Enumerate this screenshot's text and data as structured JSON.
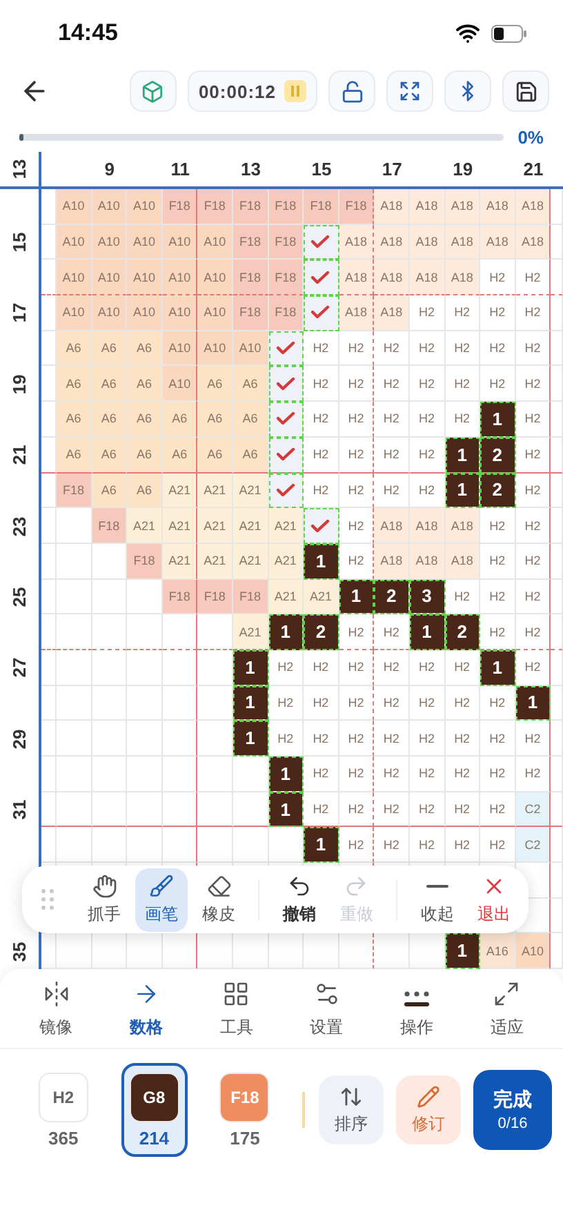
{
  "status_bar": {
    "time": "14:45"
  },
  "toolbar": {
    "timer": "00:00:12"
  },
  "progress": {
    "level": 0,
    "reading": "0%"
  },
  "grid": {
    "corner_label": "13",
    "column_labels": [
      "9",
      "11",
      "13",
      "15",
      "17",
      "19",
      "21"
    ],
    "rows": [
      {
        "cells": [
          {
            "kind": "code",
            "text": "A10",
            "color": "#f9d8bf"
          },
          {
            "kind": "code",
            "text": "A10",
            "color": "#f9d8bf"
          },
          {
            "kind": "code",
            "text": "A10",
            "color": "#f9d8bf"
          },
          {
            "kind": "code",
            "text": "F18",
            "color": "#f6c9bc"
          },
          {
            "kind": "code",
            "text": "F18",
            "color": "#f6c9bc"
          },
          {
            "kind": "code",
            "text": "F18",
            "color": "#f6c9bc"
          },
          {
            "kind": "code",
            "text": "F18",
            "color": "#f6c9bc"
          },
          {
            "kind": "code",
            "text": "F18",
            "color": "#f6c9bc"
          },
          {
            "kind": "code",
            "text": "F18",
            "color": "#f6c9bc"
          },
          {
            "kind": "code",
            "text": "A18",
            "color": "#fdeadb"
          },
          {
            "kind": "code",
            "text": "A18",
            "color": "#fdeadb"
          },
          {
            "kind": "code",
            "text": "A18",
            "color": "#fdeadb"
          },
          {
            "kind": "code",
            "text": "A18",
            "color": "#fdeadb"
          },
          {
            "kind": "code",
            "text": "A18",
            "color": "#fdeadb"
          }
        ]
      },
      {
        "label": "15",
        "cells": [
          {
            "kind": "code",
            "text": "A10",
            "color": "#f9d8bf"
          },
          {
            "kind": "code",
            "text": "A10",
            "color": "#f9d8bf"
          },
          {
            "kind": "code",
            "text": "A10",
            "color": "#f9d8bf"
          },
          {
            "kind": "code",
            "text": "A10",
            "color": "#f9d8bf"
          },
          {
            "kind": "code",
            "text": "A10",
            "color": "#f9d8bf"
          },
          {
            "kind": "code",
            "text": "F18",
            "color": "#f6c9bc"
          },
          {
            "kind": "code",
            "text": "F18",
            "color": "#f6c9bc"
          },
          {
            "kind": "check"
          },
          {
            "kind": "code",
            "text": "A18",
            "color": "#fdeadb"
          },
          {
            "kind": "code",
            "text": "A18",
            "color": "#fdeadb"
          },
          {
            "kind": "code",
            "text": "A18",
            "color": "#fdeadb"
          },
          {
            "kind": "code",
            "text": "A18",
            "color": "#fdeadb"
          },
          {
            "kind": "code",
            "text": "A18",
            "color": "#fdeadb"
          },
          {
            "kind": "code",
            "text": "A18",
            "color": "#fdeadb"
          }
        ]
      },
      {
        "cells": [
          {
            "kind": "code",
            "text": "A10",
            "color": "#f9d8bf"
          },
          {
            "kind": "code",
            "text": "A10",
            "color": "#f9d8bf"
          },
          {
            "kind": "code",
            "text": "A10",
            "color": "#f9d8bf"
          },
          {
            "kind": "code",
            "text": "A10",
            "color": "#f9d8bf"
          },
          {
            "kind": "code",
            "text": "A10",
            "color": "#f9d8bf"
          },
          {
            "kind": "code",
            "text": "F18",
            "color": "#f6c9bc"
          },
          {
            "kind": "code",
            "text": "F18",
            "color": "#f6c9bc"
          },
          {
            "kind": "check"
          },
          {
            "kind": "code",
            "text": "A18",
            "color": "#fdeadb"
          },
          {
            "kind": "code",
            "text": "A18",
            "color": "#fdeadb"
          },
          {
            "kind": "code",
            "text": "A18",
            "color": "#fdeadb"
          },
          {
            "kind": "code",
            "text": "A18",
            "color": "#fdeadb"
          },
          {
            "kind": "code",
            "text": "H2",
            "color": "#ffffff"
          },
          {
            "kind": "code",
            "text": "H2",
            "color": "#ffffff"
          }
        ]
      },
      {
        "label": "17",
        "cells": [
          {
            "kind": "code",
            "text": "A10",
            "color": "#f9d8bf"
          },
          {
            "kind": "code",
            "text": "A10",
            "color": "#f9d8bf"
          },
          {
            "kind": "code",
            "text": "A10",
            "color": "#f9d8bf"
          },
          {
            "kind": "code",
            "text": "A10",
            "color": "#f9d8bf"
          },
          {
            "kind": "code",
            "text": "A10",
            "color": "#f9d8bf"
          },
          {
            "kind": "code",
            "text": "F18",
            "color": "#f6c9bc"
          },
          {
            "kind": "code",
            "text": "F18",
            "color": "#f6c9bc"
          },
          {
            "kind": "check"
          },
          {
            "kind": "code",
            "text": "A18",
            "color": "#fdeadb"
          },
          {
            "kind": "code",
            "text": "A18",
            "color": "#fdeadb"
          },
          {
            "kind": "code",
            "text": "H2",
            "color": "#ffffff"
          },
          {
            "kind": "code",
            "text": "H2",
            "color": "#ffffff"
          },
          {
            "kind": "code",
            "text": "H2",
            "color": "#ffffff"
          },
          {
            "kind": "code",
            "text": "H2",
            "color": "#ffffff"
          }
        ]
      },
      {
        "cells": [
          {
            "kind": "code",
            "text": "A6",
            "color": "#fce3c6"
          },
          {
            "kind": "code",
            "text": "A6",
            "color": "#fce3c6"
          },
          {
            "kind": "code",
            "text": "A6",
            "color": "#fce3c6"
          },
          {
            "kind": "code",
            "text": "A10",
            "color": "#f9d8bf"
          },
          {
            "kind": "code",
            "text": "A10",
            "color": "#f9d8bf"
          },
          {
            "kind": "code",
            "text": "A10",
            "color": "#f9d8bf"
          },
          {
            "kind": "check"
          },
          {
            "kind": "code",
            "text": "H2",
            "color": "#ffffff"
          },
          {
            "kind": "code",
            "text": "H2",
            "color": "#ffffff"
          },
          {
            "kind": "code",
            "text": "H2",
            "color": "#ffffff"
          },
          {
            "kind": "code",
            "text": "H2",
            "color": "#ffffff"
          },
          {
            "kind": "code",
            "text": "H2",
            "color": "#ffffff"
          },
          {
            "kind": "code",
            "text": "H2",
            "color": "#ffffff"
          },
          {
            "kind": "code",
            "text": "H2",
            "color": "#ffffff"
          }
        ]
      },
      {
        "label": "19",
        "cells": [
          {
            "kind": "code",
            "text": "A6",
            "color": "#fce3c6"
          },
          {
            "kind": "code",
            "text": "A6",
            "color": "#fce3c6"
          },
          {
            "kind": "code",
            "text": "A6",
            "color": "#fce3c6"
          },
          {
            "kind": "code",
            "text": "A10",
            "color": "#f9d8bf"
          },
          {
            "kind": "code",
            "text": "A6",
            "color": "#fce3c6"
          },
          {
            "kind": "code",
            "text": "A6",
            "color": "#fce3c6"
          },
          {
            "kind": "check"
          },
          {
            "kind": "code",
            "text": "H2",
            "color": "#ffffff"
          },
          {
            "kind": "code",
            "text": "H2",
            "color": "#ffffff"
          },
          {
            "kind": "code",
            "text": "H2",
            "color": "#ffffff"
          },
          {
            "kind": "code",
            "text": "H2",
            "color": "#ffffff"
          },
          {
            "kind": "code",
            "text": "H2",
            "color": "#ffffff"
          },
          {
            "kind": "code",
            "text": "H2",
            "color": "#ffffff"
          },
          {
            "kind": "code",
            "text": "H2",
            "color": "#ffffff"
          }
        ]
      },
      {
        "cells": [
          {
            "kind": "code",
            "text": "A6",
            "color": "#fce3c6"
          },
          {
            "kind": "code",
            "text": "A6",
            "color": "#fce3c6"
          },
          {
            "kind": "code",
            "text": "A6",
            "color": "#fce3c6"
          },
          {
            "kind": "code",
            "text": "A6",
            "color": "#fce3c6"
          },
          {
            "kind": "code",
            "text": "A6",
            "color": "#fce3c6"
          },
          {
            "kind": "code",
            "text": "A6",
            "color": "#fce3c6"
          },
          {
            "kind": "check"
          },
          {
            "kind": "code",
            "text": "H2",
            "color": "#ffffff"
          },
          {
            "kind": "code",
            "text": "H2",
            "color": "#ffffff"
          },
          {
            "kind": "code",
            "text": "H2",
            "color": "#ffffff"
          },
          {
            "kind": "code",
            "text": "H2",
            "color": "#ffffff"
          },
          {
            "kind": "code",
            "text": "H2",
            "color": "#ffffff"
          },
          {
            "kind": "mark",
            "text": "1"
          },
          {
            "kind": "code",
            "text": "H2",
            "color": "#ffffff"
          }
        ]
      },
      {
        "label": "21",
        "cells": [
          {
            "kind": "code",
            "text": "A6",
            "color": "#fce3c6"
          },
          {
            "kind": "code",
            "text": "A6",
            "color": "#fce3c6"
          },
          {
            "kind": "code",
            "text": "A6",
            "color": "#fce3c6"
          },
          {
            "kind": "code",
            "text": "A6",
            "color": "#fce3c6"
          },
          {
            "kind": "code",
            "text": "A6",
            "color": "#fce3c6"
          },
          {
            "kind": "code",
            "text": "A6",
            "color": "#fce3c6"
          },
          {
            "kind": "check"
          },
          {
            "kind": "code",
            "text": "H2",
            "color": "#ffffff"
          },
          {
            "kind": "code",
            "text": "H2",
            "color": "#ffffff"
          },
          {
            "kind": "code",
            "text": "H2",
            "color": "#ffffff"
          },
          {
            "kind": "code",
            "text": "H2",
            "color": "#ffffff"
          },
          {
            "kind": "mark",
            "text": "1"
          },
          {
            "kind": "mark",
            "text": "2"
          },
          {
            "kind": "code",
            "text": "H2",
            "color": "#ffffff"
          }
        ]
      },
      {
        "cells": [
          {
            "kind": "code",
            "text": "F18",
            "color": "#f6c9bc"
          },
          {
            "kind": "code",
            "text": "A6",
            "color": "#fce3c6"
          },
          {
            "kind": "code",
            "text": "A6",
            "color": "#fce3c6"
          },
          {
            "kind": "code",
            "text": "A21",
            "color": "#fdeed8"
          },
          {
            "kind": "code",
            "text": "A21",
            "color": "#fdeed8"
          },
          {
            "kind": "code",
            "text": "A21",
            "color": "#fdeed8"
          },
          {
            "kind": "check"
          },
          {
            "kind": "code",
            "text": "H2",
            "color": "#ffffff"
          },
          {
            "kind": "code",
            "text": "H2",
            "color": "#ffffff"
          },
          {
            "kind": "code",
            "text": "H2",
            "color": "#ffffff"
          },
          {
            "kind": "code",
            "text": "H2",
            "color": "#ffffff"
          },
          {
            "kind": "mark",
            "text": "1"
          },
          {
            "kind": "mark",
            "text": "2"
          },
          {
            "kind": "code",
            "text": "H2",
            "color": "#ffffff"
          }
        ]
      },
      {
        "label": "23",
        "cells": [
          {
            "kind": "blank"
          },
          {
            "kind": "code",
            "text": "F18",
            "color": "#f6c9bc"
          },
          {
            "kind": "code",
            "text": "A21",
            "color": "#fdeed8"
          },
          {
            "kind": "code",
            "text": "A21",
            "color": "#fdeed8"
          },
          {
            "kind": "code",
            "text": "A21",
            "color": "#fdeed8"
          },
          {
            "kind": "code",
            "text": "A21",
            "color": "#fdeed8"
          },
          {
            "kind": "code",
            "text": "A21",
            "color": "#fdeed8"
          },
          {
            "kind": "check"
          },
          {
            "kind": "code",
            "text": "H2",
            "color": "#ffffff"
          },
          {
            "kind": "code",
            "text": "A18",
            "color": "#fdeadb"
          },
          {
            "kind": "code",
            "text": "A18",
            "color": "#fdeadb"
          },
          {
            "kind": "code",
            "text": "A18",
            "color": "#fdeadb"
          },
          {
            "kind": "code",
            "text": "H2",
            "color": "#ffffff"
          },
          {
            "kind": "code",
            "text": "H2",
            "color": "#ffffff"
          }
        ]
      },
      {
        "cells": [
          {
            "kind": "blank"
          },
          {
            "kind": "blank"
          },
          {
            "kind": "code",
            "text": "F18",
            "color": "#f6c9bc"
          },
          {
            "kind": "code",
            "text": "A21",
            "color": "#fdeed8"
          },
          {
            "kind": "code",
            "text": "A21",
            "color": "#fdeed8"
          },
          {
            "kind": "code",
            "text": "A21",
            "color": "#fdeed8"
          },
          {
            "kind": "code",
            "text": "A21",
            "color": "#fdeed8"
          },
          {
            "kind": "mark",
            "text": "1"
          },
          {
            "kind": "code",
            "text": "H2",
            "color": "#ffffff"
          },
          {
            "kind": "code",
            "text": "A18",
            "color": "#fdeadb"
          },
          {
            "kind": "code",
            "text": "A18",
            "color": "#fdeadb"
          },
          {
            "kind": "code",
            "text": "A18",
            "color": "#fdeadb"
          },
          {
            "kind": "code",
            "text": "H2",
            "color": "#ffffff"
          },
          {
            "kind": "code",
            "text": "H2",
            "color": "#ffffff"
          }
        ]
      },
      {
        "label": "25",
        "cells": [
          {
            "kind": "blank"
          },
          {
            "kind": "blank"
          },
          {
            "kind": "blank"
          },
          {
            "kind": "code",
            "text": "F18",
            "color": "#f6c9bc"
          },
          {
            "kind": "code",
            "text": "F18",
            "color": "#f6c9bc"
          },
          {
            "kind": "code",
            "text": "F18",
            "color": "#f6c9bc"
          },
          {
            "kind": "code",
            "text": "A21",
            "color": "#fdeed8"
          },
          {
            "kind": "code",
            "text": "A21",
            "color": "#fdeed8"
          },
          {
            "kind": "mark",
            "text": "1"
          },
          {
            "kind": "mark",
            "text": "2"
          },
          {
            "kind": "mark",
            "text": "3"
          },
          {
            "kind": "code",
            "text": "H2",
            "color": "#ffffff"
          },
          {
            "kind": "code",
            "text": "H2",
            "color": "#ffffff"
          },
          {
            "kind": "code",
            "text": "H2",
            "color": "#ffffff"
          }
        ]
      },
      {
        "cells": [
          {
            "kind": "blank"
          },
          {
            "kind": "blank"
          },
          {
            "kind": "blank"
          },
          {
            "kind": "blank"
          },
          {
            "kind": "blank"
          },
          {
            "kind": "code",
            "text": "A21",
            "color": "#fdeed8"
          },
          {
            "kind": "mark",
            "text": "1"
          },
          {
            "kind": "mark",
            "text": "2"
          },
          {
            "kind": "code",
            "text": "H2",
            "color": "#ffffff"
          },
          {
            "kind": "code",
            "text": "H2",
            "color": "#ffffff"
          },
          {
            "kind": "mark",
            "text": "1"
          },
          {
            "kind": "mark",
            "text": "2"
          },
          {
            "kind": "code",
            "text": "H2",
            "color": "#ffffff"
          },
          {
            "kind": "code",
            "text": "H2",
            "color": "#ffffff"
          }
        ]
      },
      {
        "label": "27",
        "cells": [
          {
            "kind": "blank"
          },
          {
            "kind": "blank"
          },
          {
            "kind": "blank"
          },
          {
            "kind": "blank"
          },
          {
            "kind": "blank"
          },
          {
            "kind": "mark",
            "text": "1"
          },
          {
            "kind": "code",
            "text": "H2",
            "color": "#ffffff"
          },
          {
            "kind": "code",
            "text": "H2",
            "color": "#ffffff"
          },
          {
            "kind": "code",
            "text": "H2",
            "color": "#ffffff"
          },
          {
            "kind": "code",
            "text": "H2",
            "color": "#ffffff"
          },
          {
            "kind": "code",
            "text": "H2",
            "color": "#ffffff"
          },
          {
            "kind": "code",
            "text": "H2",
            "color": "#ffffff"
          },
          {
            "kind": "mark",
            "text": "1"
          },
          {
            "kind": "code",
            "text": "H2",
            "color": "#ffffff"
          }
        ]
      },
      {
        "cells": [
          {
            "kind": "blank"
          },
          {
            "kind": "blank"
          },
          {
            "kind": "blank"
          },
          {
            "kind": "blank"
          },
          {
            "kind": "blank"
          },
          {
            "kind": "mark",
            "text": "1"
          },
          {
            "kind": "code",
            "text": "H2",
            "color": "#ffffff"
          },
          {
            "kind": "code",
            "text": "H2",
            "color": "#ffffff"
          },
          {
            "kind": "code",
            "text": "H2",
            "color": "#ffffff"
          },
          {
            "kind": "code",
            "text": "H2",
            "color": "#ffffff"
          },
          {
            "kind": "code",
            "text": "H2",
            "color": "#ffffff"
          },
          {
            "kind": "code",
            "text": "H2",
            "color": "#ffffff"
          },
          {
            "kind": "code",
            "text": "H2",
            "color": "#ffffff"
          },
          {
            "kind": "mark",
            "text": "1"
          }
        ]
      },
      {
        "label": "29",
        "cells": [
          {
            "kind": "blank"
          },
          {
            "kind": "blank"
          },
          {
            "kind": "blank"
          },
          {
            "kind": "blank"
          },
          {
            "kind": "blank"
          },
          {
            "kind": "mark",
            "text": "1"
          },
          {
            "kind": "code",
            "text": "H2",
            "color": "#ffffff"
          },
          {
            "kind": "code",
            "text": "H2",
            "color": "#ffffff"
          },
          {
            "kind": "code",
            "text": "H2",
            "color": "#ffffff"
          },
          {
            "kind": "code",
            "text": "H2",
            "color": "#ffffff"
          },
          {
            "kind": "code",
            "text": "H2",
            "color": "#ffffff"
          },
          {
            "kind": "code",
            "text": "H2",
            "color": "#ffffff"
          },
          {
            "kind": "code",
            "text": "H2",
            "color": "#ffffff"
          },
          {
            "kind": "code",
            "text": "H2",
            "color": "#ffffff"
          }
        ]
      },
      {
        "cells": [
          {
            "kind": "blank"
          },
          {
            "kind": "blank"
          },
          {
            "kind": "blank"
          },
          {
            "kind": "blank"
          },
          {
            "kind": "blank"
          },
          {
            "kind": "blank"
          },
          {
            "kind": "mark",
            "text": "1"
          },
          {
            "kind": "code",
            "text": "H2",
            "color": "#ffffff"
          },
          {
            "kind": "code",
            "text": "H2",
            "color": "#ffffff"
          },
          {
            "kind": "code",
            "text": "H2",
            "color": "#ffffff"
          },
          {
            "kind": "code",
            "text": "H2",
            "color": "#ffffff"
          },
          {
            "kind": "code",
            "text": "H2",
            "color": "#ffffff"
          },
          {
            "kind": "code",
            "text": "H2",
            "color": "#ffffff"
          },
          {
            "kind": "code",
            "text": "H2",
            "color": "#ffffff"
          }
        ]
      },
      {
        "label": "31",
        "cells": [
          {
            "kind": "blank"
          },
          {
            "kind": "blank"
          },
          {
            "kind": "blank"
          },
          {
            "kind": "blank"
          },
          {
            "kind": "blank"
          },
          {
            "kind": "blank"
          },
          {
            "kind": "mark",
            "text": "1"
          },
          {
            "kind": "code",
            "text": "H2",
            "color": "#ffffff"
          },
          {
            "kind": "code",
            "text": "H2",
            "color": "#ffffff"
          },
          {
            "kind": "code",
            "text": "H2",
            "color": "#ffffff"
          },
          {
            "kind": "code",
            "text": "H2",
            "color": "#ffffff"
          },
          {
            "kind": "code",
            "text": "H2",
            "color": "#ffffff"
          },
          {
            "kind": "code",
            "text": "H2",
            "color": "#ffffff"
          },
          {
            "kind": "code",
            "text": "C2",
            "color": "#e3f3f9"
          }
        ]
      },
      {
        "cells": [
          {
            "kind": "blank"
          },
          {
            "kind": "blank"
          },
          {
            "kind": "blank"
          },
          {
            "kind": "blank"
          },
          {
            "kind": "blank"
          },
          {
            "kind": "blank"
          },
          {
            "kind": "blank"
          },
          {
            "kind": "mark",
            "text": "1"
          },
          {
            "kind": "code",
            "text": "H2",
            "color": "#ffffff"
          },
          {
            "kind": "code",
            "text": "H2",
            "color": "#ffffff"
          },
          {
            "kind": "code",
            "text": "H2",
            "color": "#ffffff"
          },
          {
            "kind": "code",
            "text": "H2",
            "color": "#ffffff"
          },
          {
            "kind": "code",
            "text": "H2",
            "color": "#ffffff"
          },
          {
            "kind": "code",
            "text": "C2",
            "color": "#e3f3f9"
          }
        ]
      },
      {
        "cells": [
          {
            "kind": "blank"
          },
          {
            "kind": "blank"
          },
          {
            "kind": "blank"
          },
          {
            "kind": "blank"
          },
          {
            "kind": "blank"
          },
          {
            "kind": "blank"
          },
          {
            "kind": "blank"
          },
          {
            "kind": "blank"
          },
          {
            "kind": "blank"
          },
          {
            "kind": "blank"
          },
          {
            "kind": "blank"
          },
          {
            "kind": "blank"
          },
          {
            "kind": "blank"
          },
          {
            "kind": "blank"
          }
        ]
      },
      {
        "cells": [
          {
            "kind": "blank"
          },
          {
            "kind": "blank"
          },
          {
            "kind": "blank"
          },
          {
            "kind": "blank"
          },
          {
            "kind": "blank"
          },
          {
            "kind": "blank"
          },
          {
            "kind": "blank"
          },
          {
            "kind": "blank"
          },
          {
            "kind": "blank"
          },
          {
            "kind": "blank"
          },
          {
            "kind": "blank"
          },
          {
            "kind": "blank"
          },
          {
            "kind": "blank"
          },
          {
            "kind": "blank"
          }
        ]
      },
      {
        "label": "35",
        "cells": [
          {
            "kind": "blank"
          },
          {
            "kind": "blank"
          },
          {
            "kind": "blank"
          },
          {
            "kind": "blank"
          },
          {
            "kind": "blank"
          },
          {
            "kind": "blank"
          },
          {
            "kind": "blank"
          },
          {
            "kind": "blank"
          },
          {
            "kind": "blank"
          },
          {
            "kind": "blank"
          },
          {
            "kind": "blank"
          },
          {
            "kind": "mark",
            "text": "1"
          },
          {
            "kind": "code",
            "text": "A16",
            "color": "#fbe4cf"
          },
          {
            "kind": "code",
            "text": "A10",
            "color": "#f9d8bf"
          }
        ]
      }
    ]
  },
  "floating_tools": [
    {
      "kind": "tool",
      "label": "抓手",
      "selected": false
    },
    {
      "kind": "tool",
      "label": "画笔",
      "selected": true
    },
    {
      "kind": "tool",
      "label": "橡皮",
      "selected": false
    },
    {
      "kind": "action",
      "label": "撤销",
      "disabled": false
    },
    {
      "kind": "action",
      "label": "重做",
      "disabled": true
    },
    {
      "kind": "collapse",
      "label": "收起"
    },
    {
      "kind": "danger",
      "label": "退出"
    }
  ],
  "tabs": [
    {
      "label": "镜像",
      "selected": false,
      "marked": false
    },
    {
      "label": "数格",
      "selected": true,
      "marked": false
    },
    {
      "label": "工具",
      "selected": false,
      "marked": false
    },
    {
      "label": "设置",
      "selected": false,
      "marked": false
    },
    {
      "label": "操作",
      "selected": false,
      "marked": true
    },
    {
      "label": "适应",
      "selected": false,
      "marked": false
    }
  ],
  "swatches": [
    {
      "code": "H2",
      "count": "365",
      "color": "#ffffff",
      "selected": false
    },
    {
      "code": "G8",
      "count": "214",
      "color": "#4a2718",
      "selected": true
    },
    {
      "code": "F18",
      "count": "175",
      "color": "#ef8d61",
      "selected": false
    }
  ],
  "actions": [
    {
      "kind": "sort",
      "label": "排序"
    },
    {
      "kind": "revise",
      "label": "修订"
    },
    {
      "kind": "done",
      "label": "完成",
      "sub": "0/16"
    }
  ]
}
